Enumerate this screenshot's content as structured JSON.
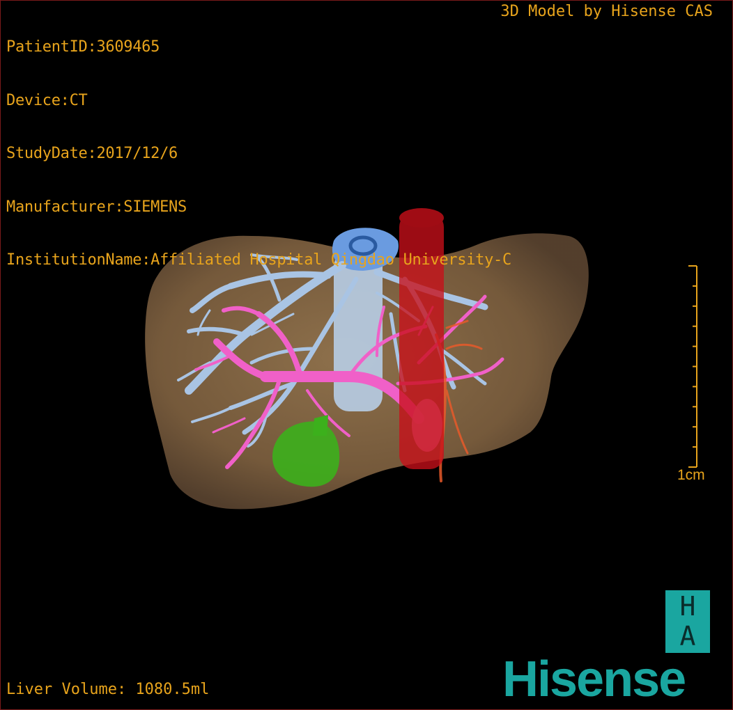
{
  "patient_info": {
    "patient_id": "PatientID:3609465",
    "device": "Device:CT",
    "study_date": "StudyDate:2017/12/6",
    "manufacturer": "Manufacturer:SIEMENS",
    "institution": "InstitutionName:Affiliated Hospital Qingdao University-C"
  },
  "credit": "3D Model by Hisense CAS",
  "liver_volume": "Liver Volume: 1080.5ml",
  "scale": {
    "label": "1cm",
    "ticks": 10
  },
  "logo": {
    "top_letter": "H",
    "bottom_letter": "A",
    "brand": "Hisense"
  },
  "model": {
    "structures": [
      {
        "name": "liver",
        "color": "#8a6a44"
      },
      {
        "name": "hepatic-vein",
        "color": "#a9c4e4"
      },
      {
        "name": "inferior-vena-cava",
        "color": "#b7cde6"
      },
      {
        "name": "portal-vein",
        "color": "#f060c8"
      },
      {
        "name": "aorta",
        "color": "#c8101a"
      },
      {
        "name": "hepatic-artery",
        "color": "#e85a2a"
      },
      {
        "name": "gallbladder",
        "color": "#3cb01c"
      }
    ]
  },
  "colors": {
    "text": "#e8a41c",
    "brand": "#1aa6a0",
    "border": "#7a1a1a",
    "background": "#000000"
  }
}
